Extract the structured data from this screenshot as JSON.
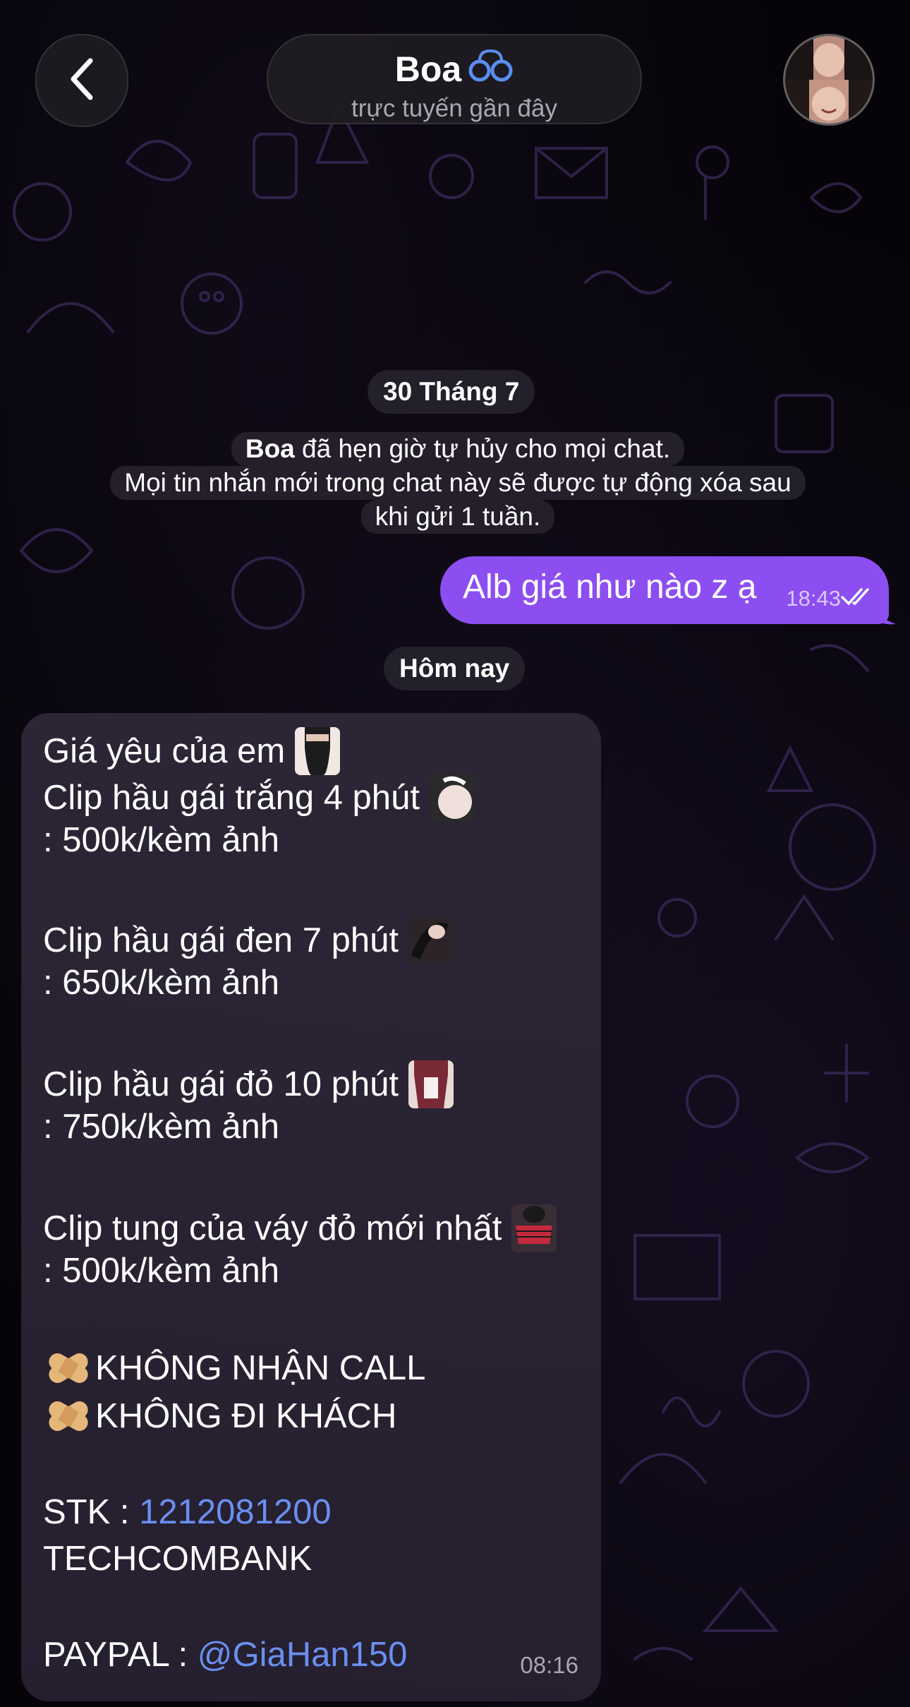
{
  "header": {
    "contact_name": "Boa",
    "status": "trực tuyến gần đây"
  },
  "chat": {
    "date_chip_1": "30 Tháng 7",
    "service_message": {
      "actor": "Boa",
      "line1_rest": " đã hẹn giờ tự hủy cho mọi chat.",
      "line2": "Mọi tin nhắn mới trong chat này sẽ được tự động xóa sau",
      "line3": "khi gửi 1 tuần."
    },
    "outgoing_message": {
      "text": "Alb giá như nào z ạ",
      "time": "18:43"
    },
    "date_chip_2": "Hôm nay",
    "incoming_message": {
      "lines": [
        "Giá yêu của em",
        "Clip hầu gái trắng 4 phút",
        ": 500k/kèm ảnh",
        "Clip hầu gái đen 7 phút",
        " : 650k/kèm ảnh",
        "Clip hầu gái đỏ 10 phút",
        ": 750k/kèm ảnh",
        "Clip tung của váy đỏ mới nhất",
        ": 500k/kèm ảnh",
        "KHÔNG NHẬN CALL",
        "KHÔNG ĐI KHÁCH",
        "STK : ",
        "1212081200",
        "TECHCOMBANK",
        "PAYPAL : ",
        "@GiaHan150"
      ],
      "time": "08:16"
    }
  },
  "colors": {
    "outgoing_bubble": "#8c4ef0",
    "link": "#6a8ff0",
    "background": "#060409"
  },
  "icons": {
    "back": "chevron-left-icon",
    "title_emoji": "handcuffs-icon",
    "read_receipt": "double-check-icon",
    "bullet": "bandage-icon"
  }
}
